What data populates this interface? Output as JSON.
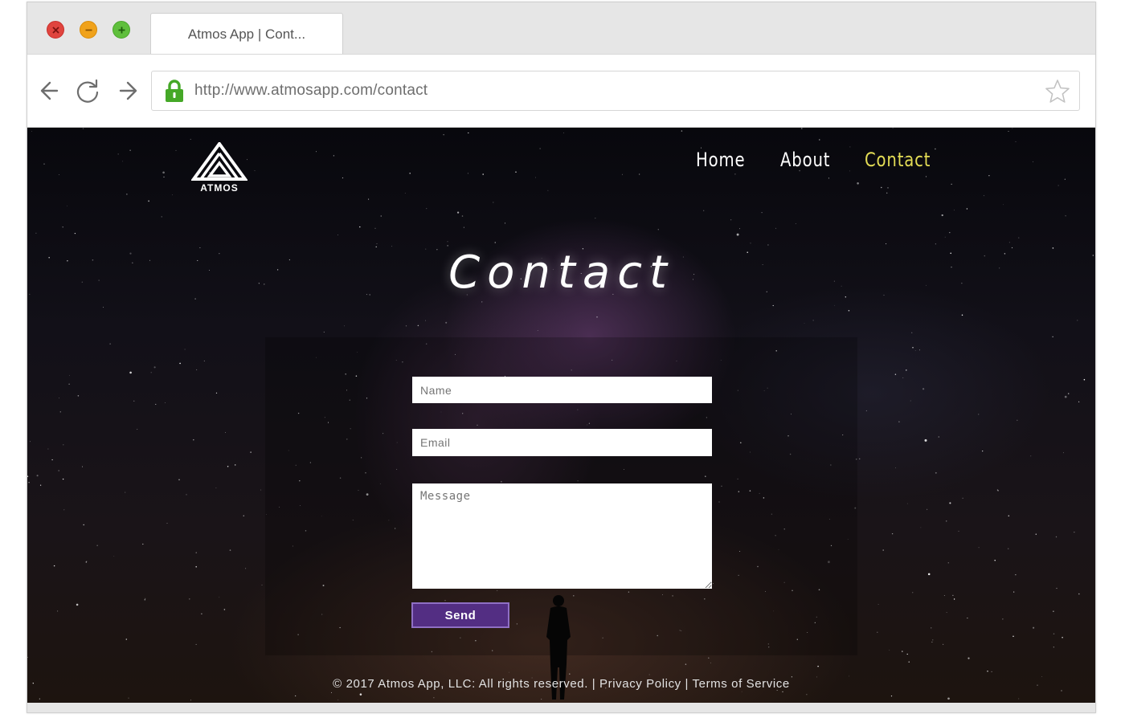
{
  "browser": {
    "tab_title": "Atmos App | Cont...",
    "url": "http://www.atmosapp.com/contact"
  },
  "site": {
    "logo_text": "ATMOS",
    "nav": [
      {
        "label": "Home"
      },
      {
        "label": "About"
      },
      {
        "label": "Contact",
        "active": true
      }
    ],
    "heading": "Contact",
    "form": {
      "name_placeholder": "Name",
      "email_placeholder": "Email",
      "message_placeholder": "Message",
      "send_label": "Send"
    },
    "footer": "© 2017 Atmos App, LLC. All rights reserved. | Privacy Policy | Terms of Service"
  },
  "colors": {
    "active_nav": "#e3dc55",
    "send_button": "#532e83"
  }
}
